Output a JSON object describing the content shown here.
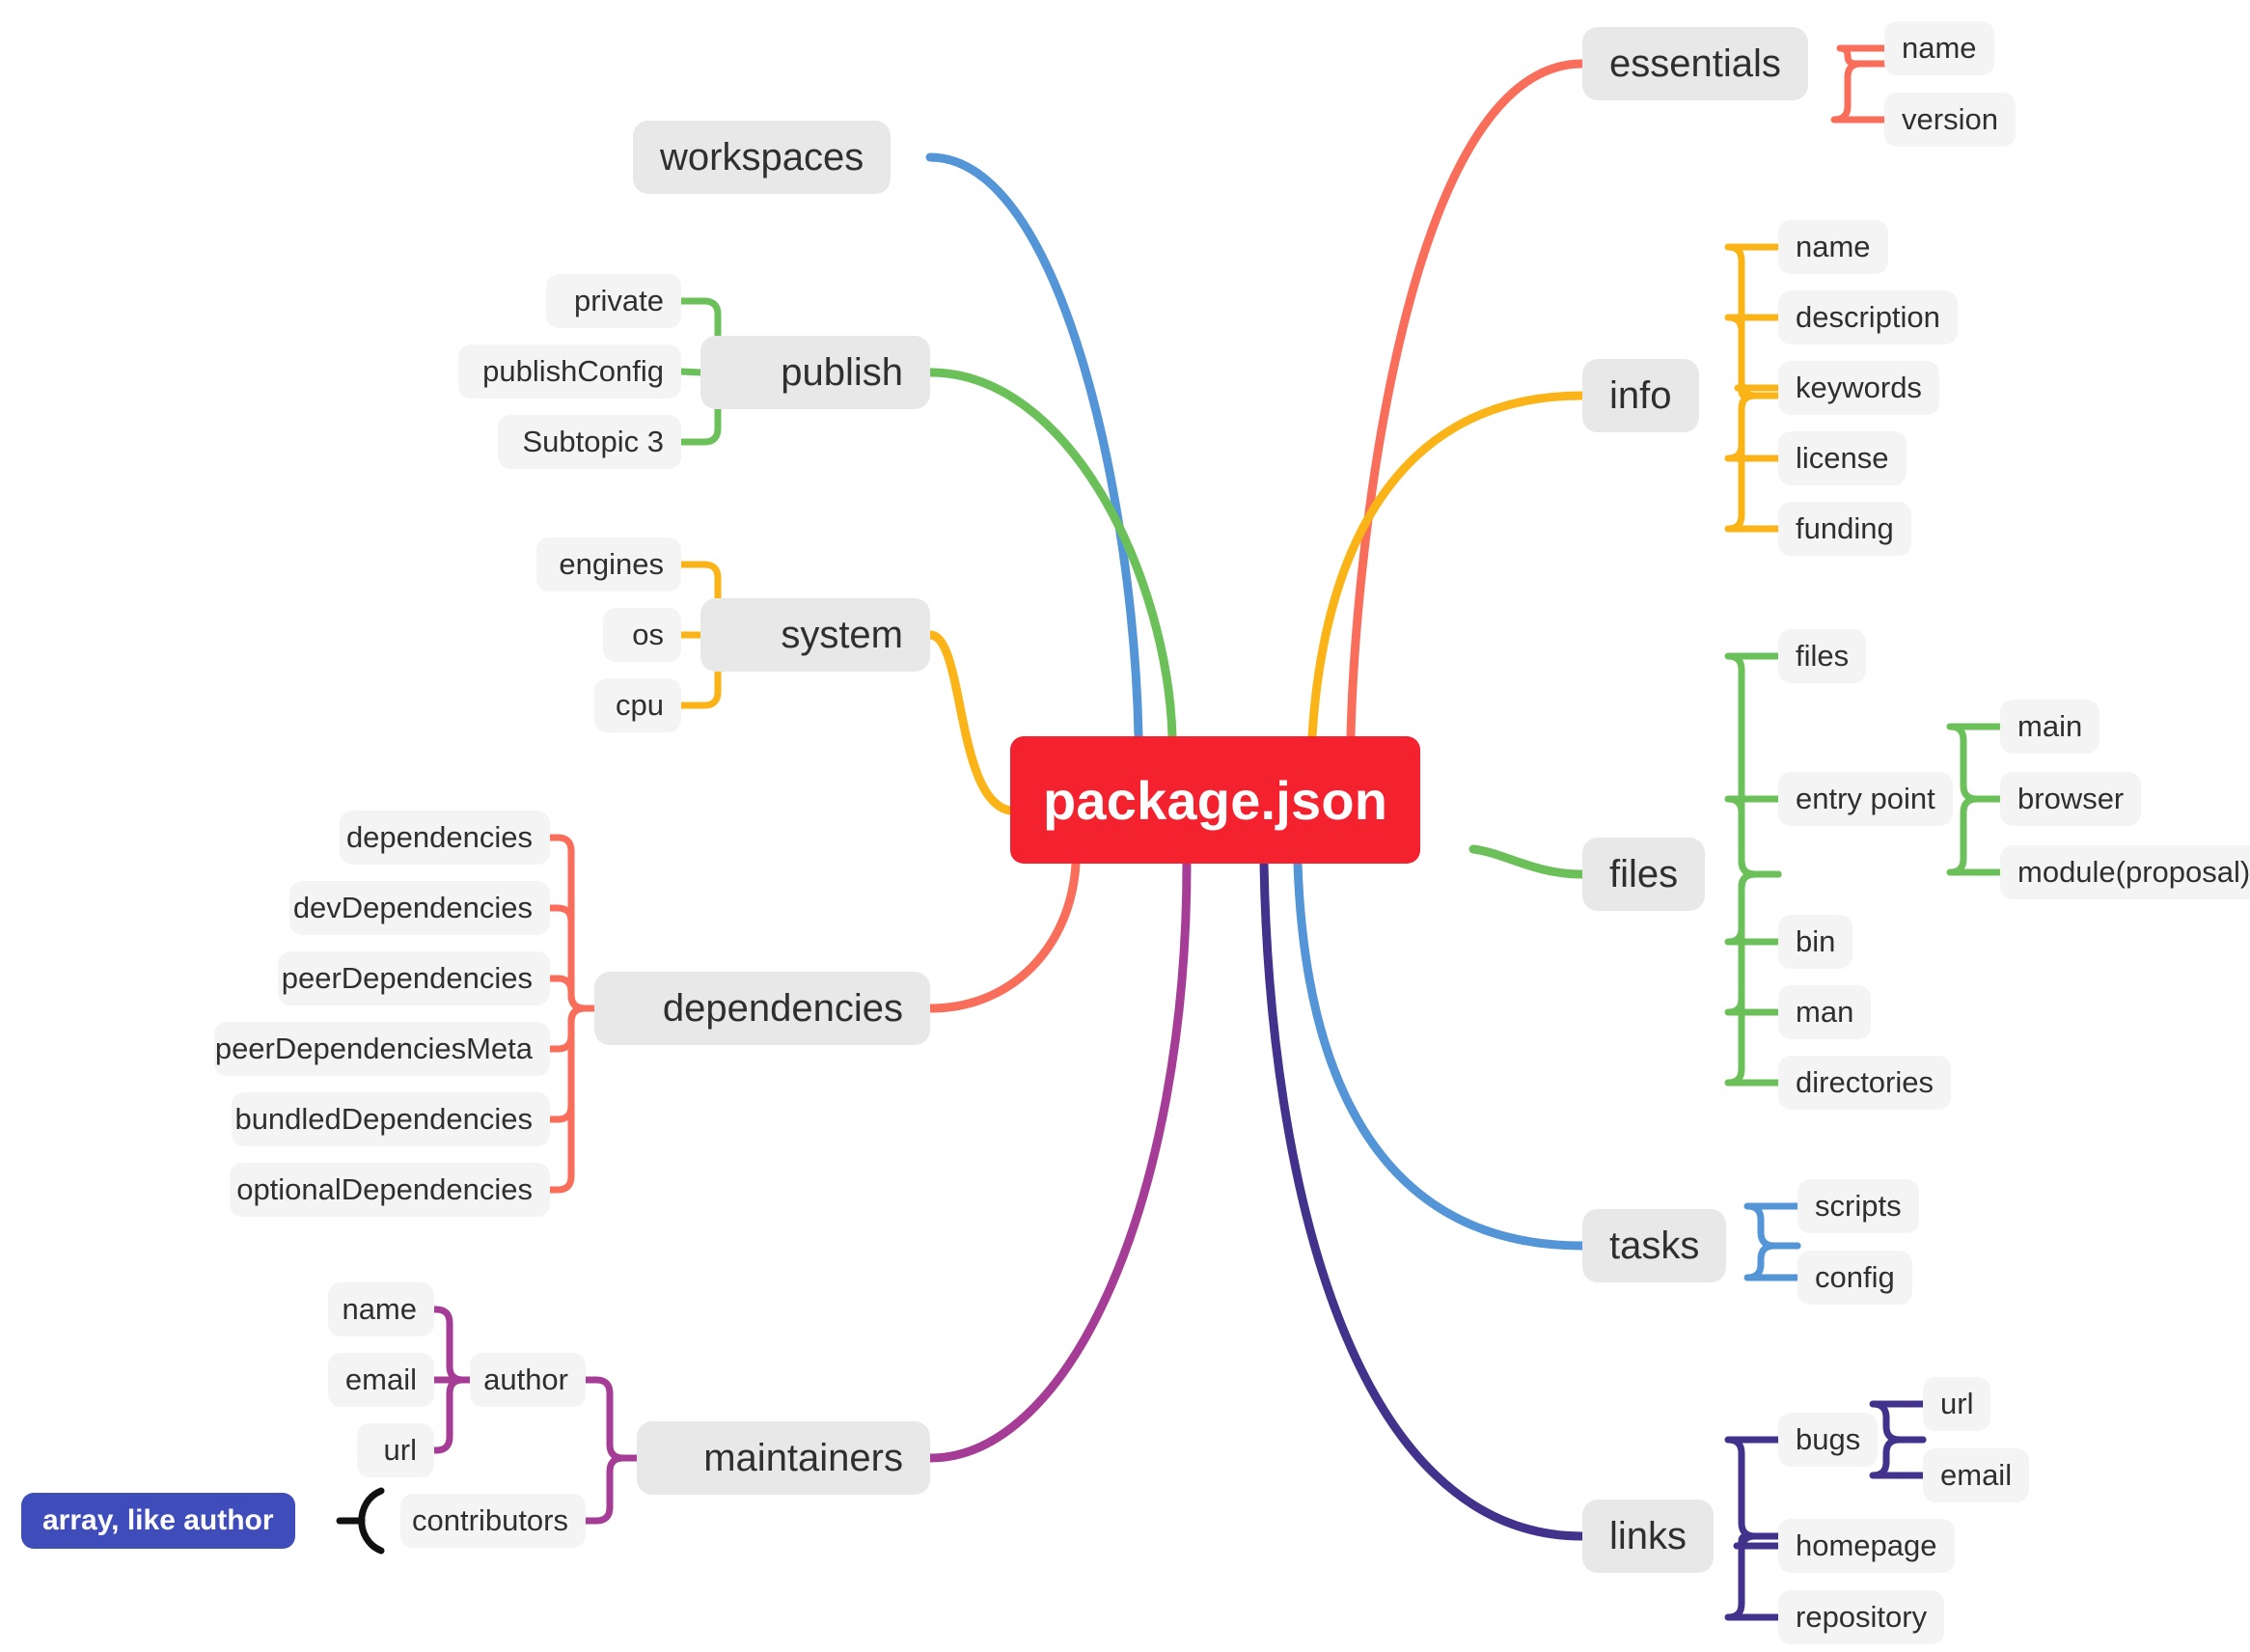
{
  "root": {
    "label": "package.json",
    "color": "#F4212E"
  },
  "branches": [
    {
      "id": "essentials",
      "label": "essentials",
      "color": "#F96D5B",
      "side": "right",
      "children": [
        {
          "label": "name"
        },
        {
          "label": "version"
        }
      ]
    },
    {
      "id": "info",
      "label": "info",
      "color": "#FBB417",
      "side": "right",
      "children": [
        {
          "label": "name"
        },
        {
          "label": "description"
        },
        {
          "label": "keywords"
        },
        {
          "label": "license"
        },
        {
          "label": "funding"
        }
      ]
    },
    {
      "id": "files",
      "label": "files",
      "color": "#6CC05A",
      "side": "right",
      "children": [
        {
          "label": "files"
        },
        {
          "label": "entry point",
          "children": [
            {
              "label": "main"
            },
            {
              "label": "browser"
            },
            {
              "label": "module(proposal)"
            }
          ]
        },
        {
          "label": "bin"
        },
        {
          "label": "man"
        },
        {
          "label": "directories"
        }
      ]
    },
    {
      "id": "tasks",
      "label": "tasks",
      "color": "#5395D6",
      "side": "right",
      "children": [
        {
          "label": "scripts"
        },
        {
          "label": "config"
        }
      ]
    },
    {
      "id": "links",
      "label": "links",
      "color": "#42328C",
      "side": "right",
      "children": [
        {
          "label": "bugs",
          "children": [
            {
              "label": "url"
            },
            {
              "label": "email"
            }
          ]
        },
        {
          "label": "homepage"
        },
        {
          "label": "repository"
        }
      ]
    },
    {
      "id": "workspaces",
      "label": "workspaces",
      "color": "#5395D6",
      "side": "left",
      "children": []
    },
    {
      "id": "publish",
      "label": "publish",
      "color": "#6CC05A",
      "side": "left",
      "children": [
        {
          "label": "private"
        },
        {
          "label": "publishConfig"
        },
        {
          "label": "Subtopic 3"
        }
      ]
    },
    {
      "id": "system",
      "label": "system",
      "color": "#FBB417",
      "side": "left",
      "children": [
        {
          "label": "engines"
        },
        {
          "label": "os"
        },
        {
          "label": "cpu"
        }
      ]
    },
    {
      "id": "dependencies",
      "label": "dependencies",
      "color": "#F96D5B",
      "side": "left",
      "children": [
        {
          "label": "dependencies"
        },
        {
          "label": "devDependencies"
        },
        {
          "label": "peerDependencies"
        },
        {
          "label": "peerDependenciesMeta"
        },
        {
          "label": "bundledDependencies"
        },
        {
          "label": "optionalDependencies"
        }
      ]
    },
    {
      "id": "maintainers",
      "label": "maintainers",
      "color": "#A53D96",
      "side": "left",
      "children": [
        {
          "label": "author",
          "children": [
            {
              "label": "name"
            },
            {
              "label": "email"
            },
            {
              "label": "url"
            }
          ]
        },
        {
          "label": "contributors"
        }
      ]
    }
  ],
  "callout": {
    "label": "array, like author",
    "color": "#3F4DBB",
    "attached_to": "contributors"
  },
  "palette": {
    "background": "#FFFFFF",
    "root_fill": "#F4212E",
    "topic_fill": "#E8E8E9",
    "leaf_fill": "#F4F4F5",
    "text": "#2F2F2F",
    "callout_fill": "#3F4DBB",
    "bracket": "#111111"
  }
}
